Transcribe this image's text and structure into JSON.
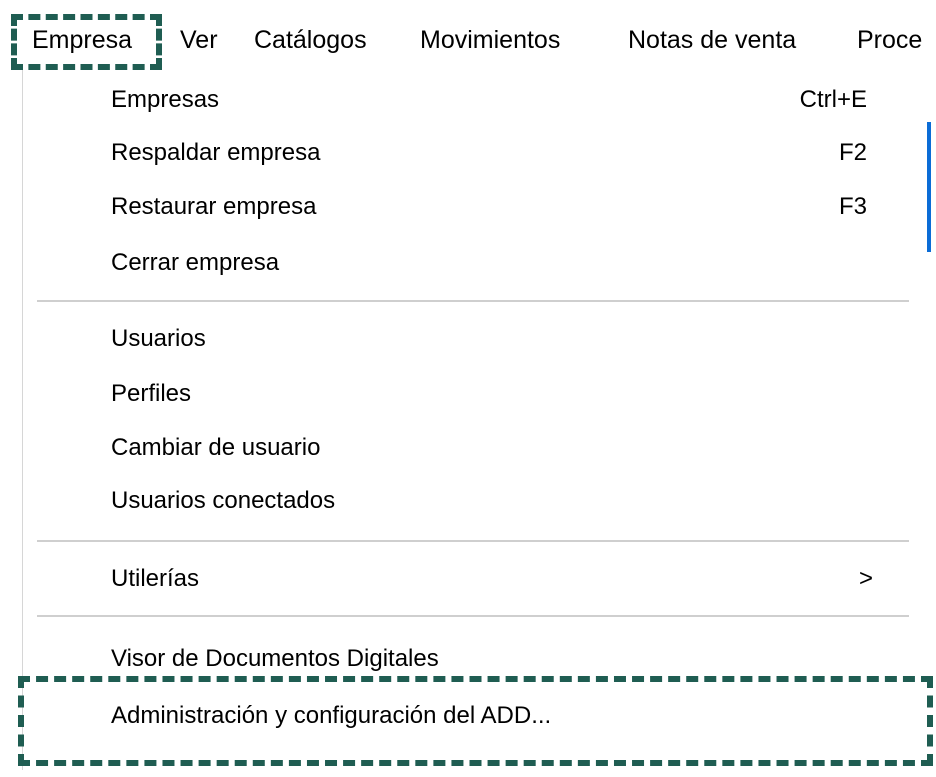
{
  "menubar": {
    "items": [
      {
        "label": "Empresa"
      },
      {
        "label": "Ver"
      },
      {
        "label": "Catálogos"
      },
      {
        "label": "Movimientos"
      },
      {
        "label": "Notas de venta"
      },
      {
        "label": "Proce"
      }
    ]
  },
  "dropdown": {
    "group1": [
      {
        "label": "Empresas",
        "shortcut": "Ctrl+E"
      },
      {
        "label": "Respaldar empresa",
        "shortcut": "F2"
      },
      {
        "label": "Restaurar empresa",
        "shortcut": "F3"
      },
      {
        "label": "Cerrar empresa",
        "shortcut": ""
      }
    ],
    "group2": [
      {
        "label": "Usuarios"
      },
      {
        "label": "Perfiles"
      },
      {
        "label": "Cambiar de usuario"
      },
      {
        "label": "Usuarios conectados"
      }
    ],
    "group3": [
      {
        "label": "Utilerías",
        "submenu_indicator": ">"
      }
    ],
    "group4": [
      {
        "label": "Visor de Documentos Digitales"
      },
      {
        "label": "Administración y configuración del ADD..."
      }
    ]
  },
  "colors": {
    "highlight_border": "#1f5d52",
    "separator": "#cfcfcf",
    "accent_scroll": "#0b6cd6"
  }
}
